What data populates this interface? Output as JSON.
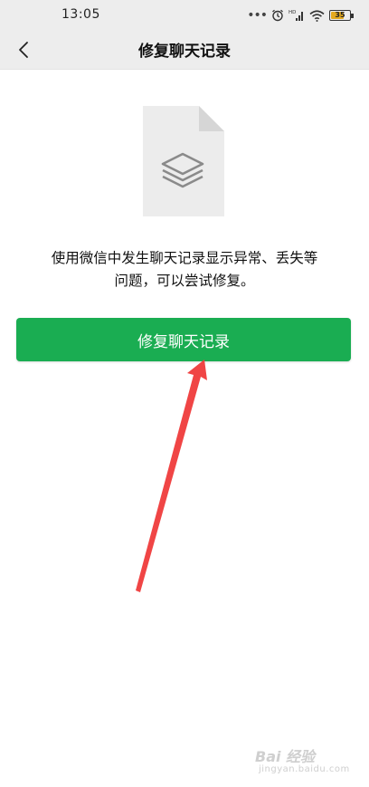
{
  "status_bar": {
    "time": "13:05",
    "battery": "35",
    "network_badge": "HD",
    "icons": [
      "dots-icon",
      "alarm-icon",
      "signal-icon",
      "wifi-icon",
      "battery-icon"
    ]
  },
  "nav": {
    "title": "修复聊天记录",
    "back_icon": "chevron-left-icon"
  },
  "illustration": {
    "icon": "document-layers-icon"
  },
  "description": {
    "line1": "使用微信中发生聊天记录显示异常、丢失等",
    "line2": "问题，可以尝试修复。"
  },
  "repair_button": {
    "label": "修复聊天记录",
    "color": "#1aad52"
  },
  "annotation": {
    "icon": "red-arrow-icon",
    "color": "#ef3b3b"
  },
  "watermark": {
    "main": "Bai 经验",
    "sub": "jingyan.baidu.com"
  }
}
